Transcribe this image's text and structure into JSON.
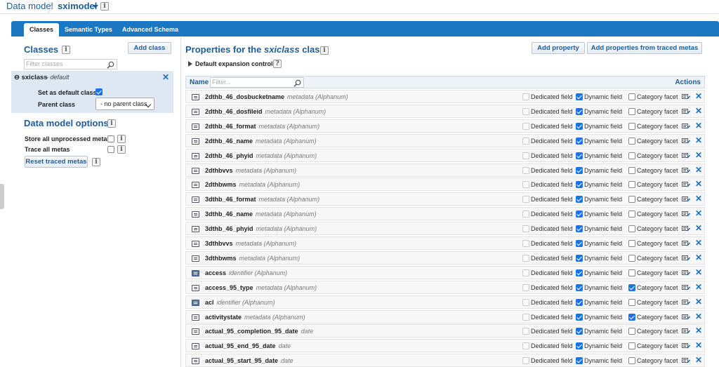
{
  "breadcrumb": {
    "root": "Data model",
    "current": "sximodel"
  },
  "tabs": [
    {
      "label": "Classes"
    },
    {
      "label": "Semantic Types"
    },
    {
      "label": "Advanced Schema"
    }
  ],
  "left": {
    "classes_title": "Classes",
    "add_class": "Add class",
    "filter_placeholder": "Filter classes",
    "selected_class": {
      "name": "sxiclass",
      "tag": "- default",
      "set_default_label": "Set as default class",
      "set_default_checked": true,
      "parent_label": "Parent class",
      "parent_value": "- no parent class"
    },
    "options_title": "Data model options",
    "store_unprocessed": "Store all unprocessed metas",
    "trace_all": "Trace all metas",
    "reset_traced": "Reset traced metas"
  },
  "right": {
    "title_prefix": "Properties for the ",
    "title_class": "sxiclass",
    "title_suffix": " class",
    "add_property": "Add property",
    "add_from_traced": "Add properties from traced metas",
    "expansion": "Default expansion control",
    "col_name": "Name",
    "name_filter_placeholder": "Filter...",
    "col_actions": "Actions",
    "labels": {
      "dedicated": "Dedicated field",
      "dynamic": "Dynamic field",
      "category": "Category facet"
    },
    "rows": [
      {
        "name": "2dthb_46_dosbucketname",
        "type": "metadata (Alphanum)",
        "kind": "meta",
        "dynamic": true,
        "category": false
      },
      {
        "name": "2dthb_46_dosfileid",
        "type": "metadata (Alphanum)",
        "kind": "meta",
        "dynamic": true,
        "category": false
      },
      {
        "name": "2dthb_46_format",
        "type": "metadata (Alphanum)",
        "kind": "meta",
        "dynamic": true,
        "category": false
      },
      {
        "name": "2dthb_46_name",
        "type": "metadata (Alphanum)",
        "kind": "meta",
        "dynamic": true,
        "category": false
      },
      {
        "name": "2dthb_46_phyid",
        "type": "metadata (Alphanum)",
        "kind": "meta",
        "dynamic": true,
        "category": false
      },
      {
        "name": "2dthbvvs",
        "type": "metadata (Alphanum)",
        "kind": "meta",
        "dynamic": true,
        "category": false
      },
      {
        "name": "2dthbwms",
        "type": "metadata (Alphanum)",
        "kind": "meta",
        "dynamic": true,
        "category": false
      },
      {
        "name": "3dthb_46_format",
        "type": "metadata (Alphanum)",
        "kind": "meta",
        "dynamic": true,
        "category": false
      },
      {
        "name": "3dthb_46_name",
        "type": "metadata (Alphanum)",
        "kind": "meta",
        "dynamic": true,
        "category": false
      },
      {
        "name": "3dthb_46_phyid",
        "type": "metadata (Alphanum)",
        "kind": "meta",
        "dynamic": true,
        "category": false
      },
      {
        "name": "3dthbvvs",
        "type": "metadata (Alphanum)",
        "kind": "meta",
        "dynamic": true,
        "category": false
      },
      {
        "name": "3dthbwms",
        "type": "metadata (Alphanum)",
        "kind": "meta",
        "dynamic": true,
        "category": false
      },
      {
        "name": "access",
        "type": "identifier (Alphanum)",
        "kind": "id",
        "dynamic": true,
        "category": false
      },
      {
        "name": "access_95_type",
        "type": "metadata (Alphanum)",
        "kind": "meta",
        "dynamic": true,
        "category": true
      },
      {
        "name": "acl",
        "type": "identifier (Alphanum)",
        "kind": "id",
        "dynamic": true,
        "category": false
      },
      {
        "name": "activitystate",
        "type": "metadata (Alphanum)",
        "kind": "meta",
        "dynamic": true,
        "category": true
      },
      {
        "name": "actual_95_completion_95_date",
        "type": "date",
        "kind": "meta",
        "dynamic": true,
        "category": false
      },
      {
        "name": "actual_95_end_95_date",
        "type": "date",
        "kind": "meta",
        "dynamic": true,
        "category": false
      },
      {
        "name": "actual_95_start_95_date",
        "type": "date",
        "kind": "meta",
        "dynamic": true,
        "category": false
      }
    ]
  },
  "colors": {
    "accent": "#1a78c2",
    "link": "#1d5d9b",
    "check": "#1a73e8",
    "selected_row": "#dde8f3"
  }
}
